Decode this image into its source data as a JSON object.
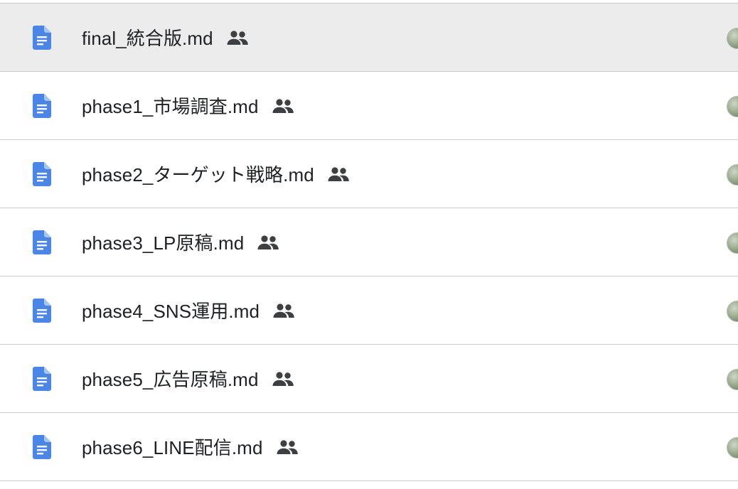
{
  "files": [
    {
      "name": "final_統合版.md",
      "selected": true
    },
    {
      "name": "phase1_市場調査.md",
      "selected": false
    },
    {
      "name": "phase2_ターゲット戦略.md",
      "selected": false
    },
    {
      "name": "phase3_LP原稿.md",
      "selected": false
    },
    {
      "name": "phase4_SNS運用.md",
      "selected": false
    },
    {
      "name": "phase5_広告原稿.md",
      "selected": false
    },
    {
      "name": "phase6_LINE配信.md",
      "selected": false
    }
  ],
  "icons": {
    "file": "google-docs-icon",
    "shared": "people-icon",
    "owner": "avatar"
  },
  "colors": {
    "doc_icon": "#4a86e8",
    "selected_row": "#ececec",
    "divider": "#c8c8c8",
    "text": "#202124",
    "shared_icon": "#3c4043"
  }
}
